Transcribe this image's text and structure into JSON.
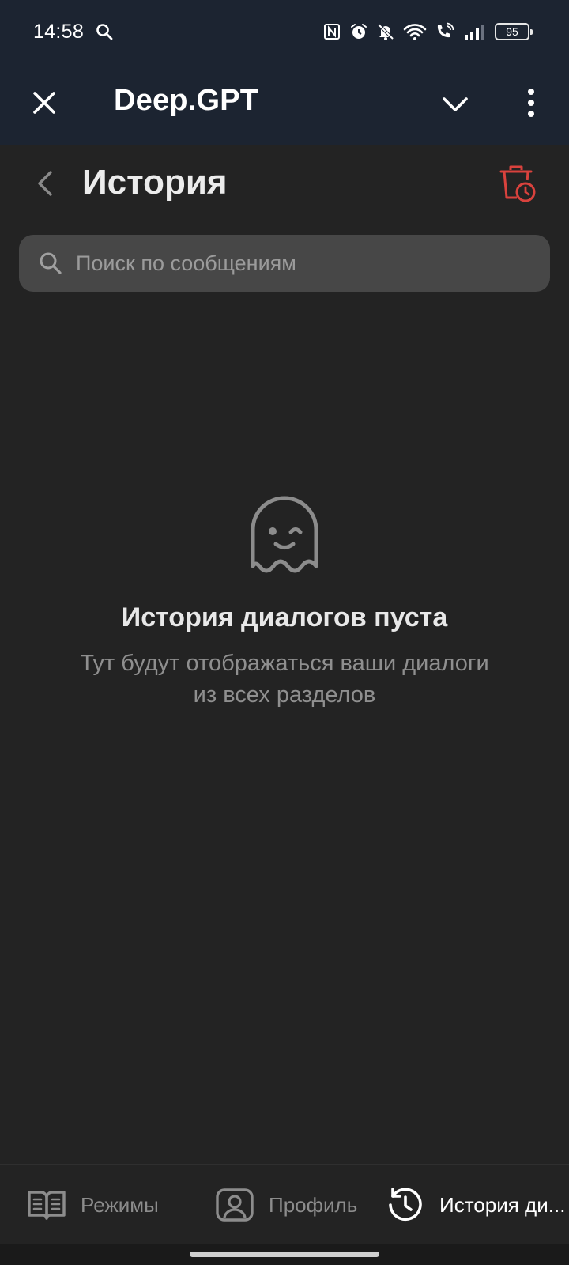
{
  "status_bar": {
    "time": "14:58",
    "battery_level": "95",
    "icons": [
      "search-icon",
      "nfc-icon",
      "alarm-icon",
      "muted-bell-icon",
      "wifi-icon",
      "wifi-call-icon",
      "signal-icon",
      "battery-icon"
    ]
  },
  "toolbar": {
    "title": "Deep.GPT",
    "icons": [
      "close-icon",
      "chevron-down-icon",
      "more-vertical-icon"
    ]
  },
  "header": {
    "title": "История",
    "icons": [
      "back-icon",
      "clear-history-icon"
    ]
  },
  "search": {
    "value": "",
    "placeholder": "Поиск по сообщениям"
  },
  "empty_state": {
    "icon": "ghost-icon",
    "title": "История диалогов пуста",
    "text": "Тут будут отображаться ваши диалоги из всех разделов"
  },
  "bottom_nav": {
    "items": [
      {
        "label": "Режимы",
        "icon": "book-icon",
        "active": false
      },
      {
        "label": "Профиль",
        "icon": "profile-icon",
        "active": false
      },
      {
        "label": "История ди...",
        "icon": "history-icon",
        "active": true
      }
    ]
  },
  "colors": {
    "background": "#232323",
    "toolbar": "#1c2431",
    "search_field": "#474747",
    "danger_accent": "#d9423d",
    "muted_text": "#8f8f8f"
  }
}
